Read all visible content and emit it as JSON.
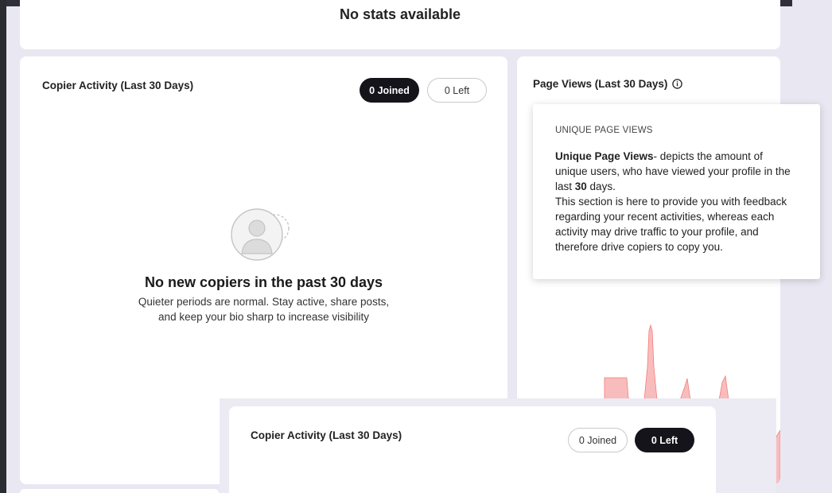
{
  "stats_card": {
    "empty_text": "No stats available"
  },
  "copier_card": {
    "title_prefix": "Copier Activity (Last ",
    "title_days": "30",
    "title_suffix": " Days)",
    "toggle_joined": "0 Joined",
    "toggle_left": "0 Left",
    "active_toggle": "joined",
    "empty_title": "No new copiers in the past 30 days",
    "empty_description": "Quieter periods are normal. Stay active, share posts, and keep your bio sharp to increase visibility"
  },
  "pageviews_card": {
    "title_prefix": "Page Views (Last ",
    "title_days": "30",
    "title_suffix": " Days)",
    "info_icon": "info-icon",
    "chart_color": "#f47b7b"
  },
  "tooltip": {
    "heading": "UNIQUE PAGE VIEWS",
    "term": "Unique Page Views",
    "line1_rest": "- depicts the amount of unique users, who have viewed your profile in the last ",
    "line1_days": "30",
    "line1_end": " days.",
    "line2": "This section is here to provide you with feedback regarding your recent activities, whereas each activity may drive traffic to your profile, and therefore drive copiers to copy you."
  },
  "copier_card_overlay": {
    "title_prefix": "Copier Activity (Last ",
    "title_days": "30",
    "title_suffix": " Days)",
    "toggle_joined": "0 Joined",
    "toggle_left": "0 Left",
    "active_toggle": "left"
  }
}
